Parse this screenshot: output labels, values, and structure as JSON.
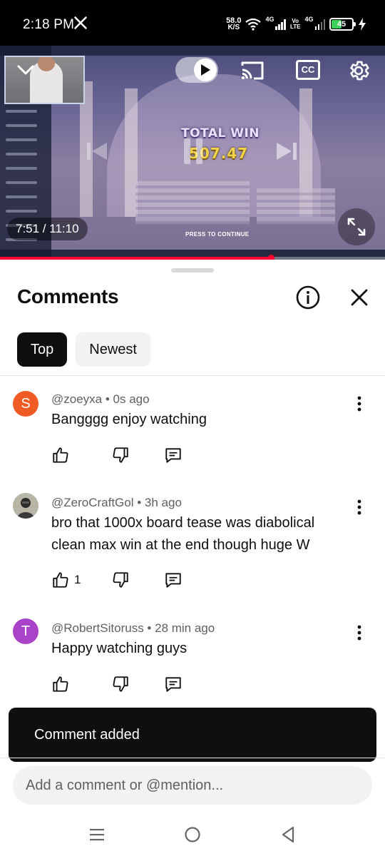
{
  "status_bar": {
    "time": "2:18 PM",
    "net_speed_value": "58.0",
    "net_speed_unit": "K/S",
    "sim1_label": "4G",
    "volte_top": "Vo",
    "volte_bottom": "LTE",
    "sim2_label": "4G",
    "battery_level": "45"
  },
  "player": {
    "time_label": "7:51 / 11:10",
    "progress": 0.703,
    "game_overlay_title": "TOTAL WIN",
    "game_overlay_amount": "507.47",
    "game_overlay_prompt": "PRESS TO CONTINUE",
    "cc_label": "CC",
    "accent_color": "#ff0033"
  },
  "comments_panel": {
    "title": "Comments",
    "tabs": [
      {
        "label": "Top",
        "active": true
      },
      {
        "label": "Newest",
        "active": false
      }
    ],
    "comments": [
      {
        "avatar_letter": "S",
        "avatar_color": "#f05a24",
        "author": "@zoeyxa",
        "time": "0s ago",
        "text": "Bangggg enjoy watching",
        "likes": ""
      },
      {
        "avatar_letter": "",
        "avatar_color": "#c9c7b8",
        "author": "@ZeroCraftGol",
        "time": "3h ago",
        "text": "bro that 1000x board tease was diabolical clean max win at the end though huge W",
        "likes": "1"
      },
      {
        "avatar_letter": "T",
        "avatar_color": "#a943c7",
        "author": "@RobertSitoruss",
        "time": "28 min ago",
        "text": "Happy watching guys",
        "likes": ""
      }
    ]
  },
  "snackbar": {
    "text": "Comment added"
  },
  "composer": {
    "placeholder": "Add a comment or @mention..."
  }
}
